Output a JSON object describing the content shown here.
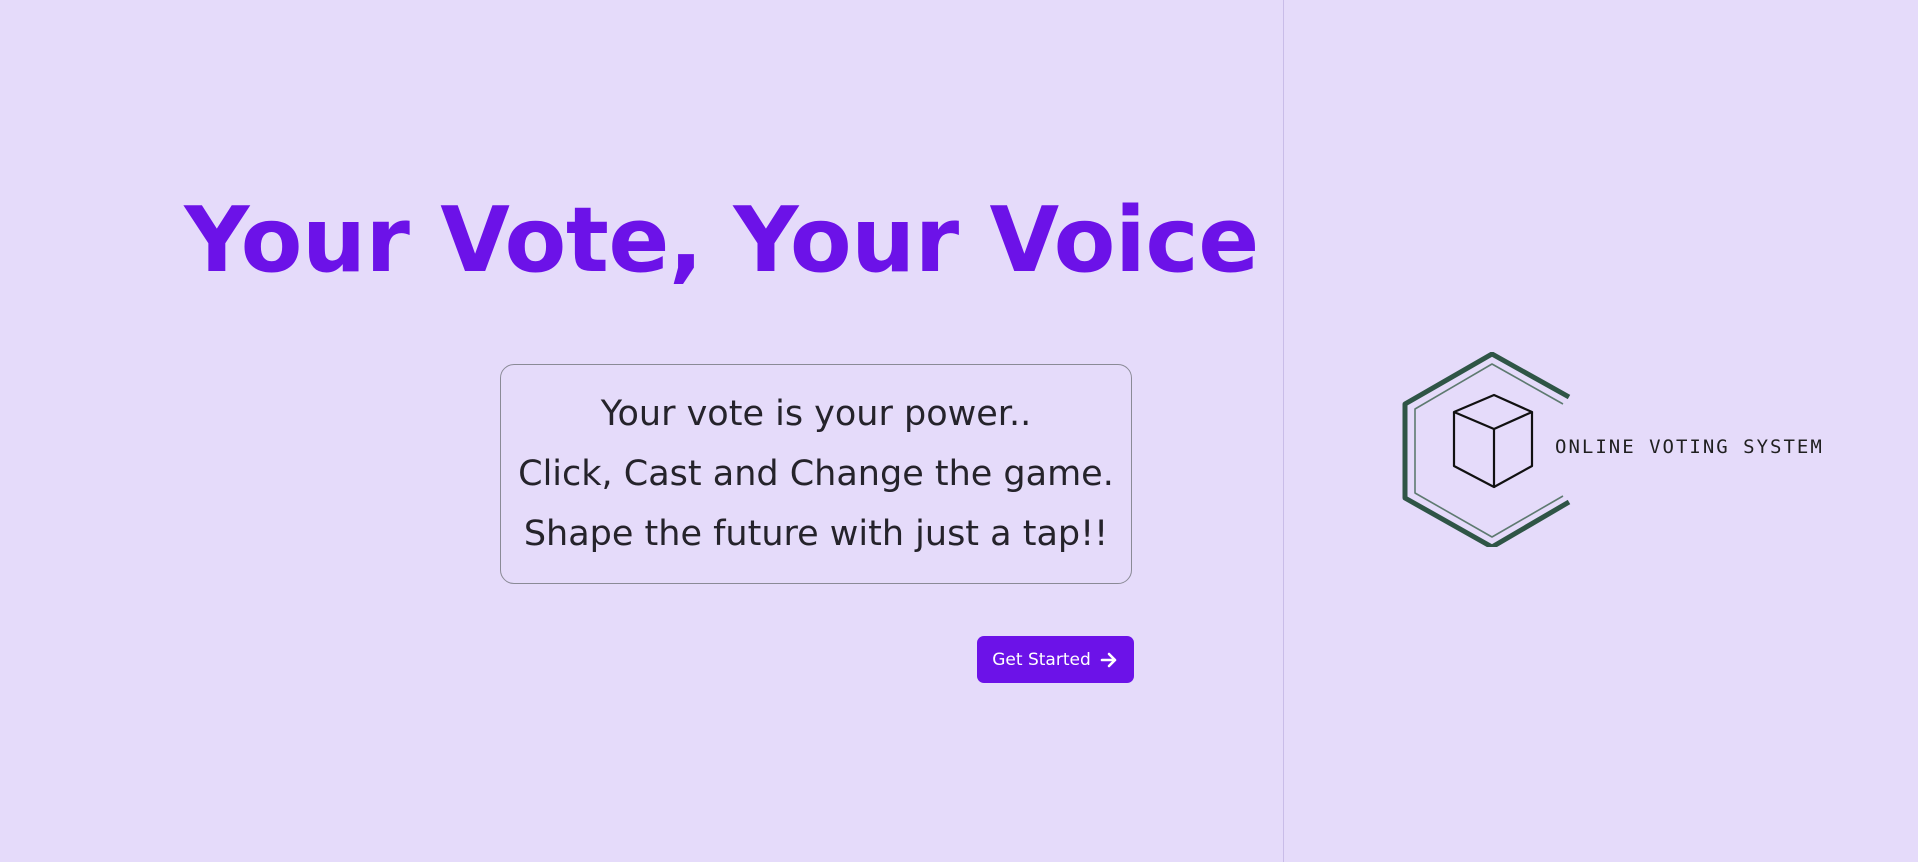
{
  "hero": {
    "title": "Your Vote, Your Voice"
  },
  "tagline": {
    "lines": [
      "Your vote is your power..",
      "Click, Cast and Change the game.",
      "Shape the future with just a tap!!"
    ]
  },
  "cta": {
    "label": "Get Started",
    "icon": "arrow-right-icon"
  },
  "logo": {
    "text": "ONLINE VOTING SYSTEM",
    "icon": "cube-hexagon-icon"
  },
  "colors": {
    "background": "#e5dbfa",
    "accent": "#6c12e8",
    "logo_ring": "#2f5546",
    "text": "#25232b"
  }
}
